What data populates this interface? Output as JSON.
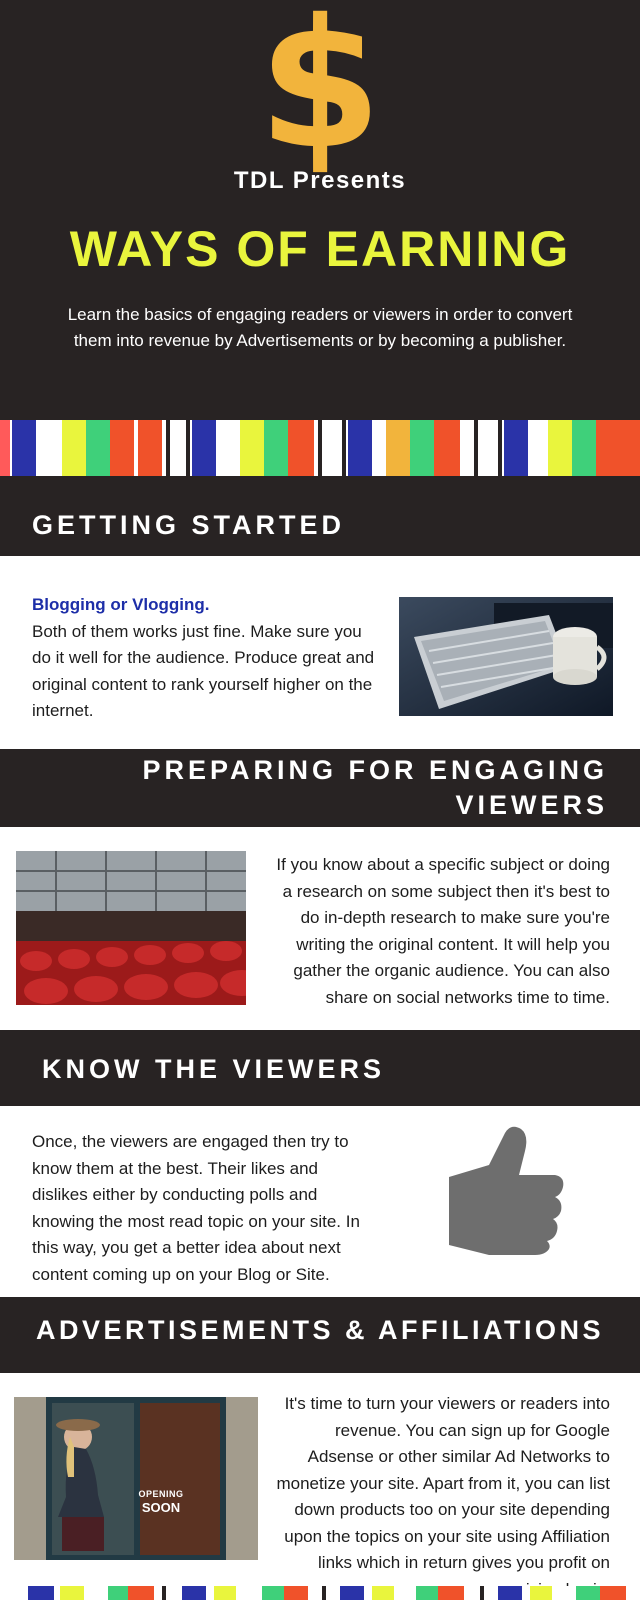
{
  "hero": {
    "icon": "dollar-icon",
    "icon_glyph": "$",
    "presents": "TDL Presents",
    "title": "WAYS OF EARNING",
    "subtitle": "Learn the basics of engaging readers or viewers in order to convert them into revenue by Advertisements or by becoming a publisher."
  },
  "colors": {
    "dark_band": "#282323",
    "dollar": "#f2b43c",
    "title": "#e9f53d",
    "kicker": "#1d2ea8",
    "strip_red": "#ff5a5a",
    "strip_blue": "#2a33a8",
    "strip_yellow": "#e9f53d",
    "strip_green": "#3fd07a",
    "strip_orange": "#f0522a",
    "strip_gold": "#f2b43c",
    "thumb": "#6e6e6e"
  },
  "sections": [
    {
      "heading": "GETTING STARTED",
      "kicker": "Blogging or Vlogging.",
      "text": "Both of them works just fine. Make sure you do it well for the audience. Produce great and original content to rank yourself higher on the internet.",
      "image": "keyboard-photo"
    },
    {
      "heading_line1": "PREPARING FOR ENGAGING",
      "heading_line2": "VIEWERS",
      "text": "If you know about a specific subject or doing a research on some subject then it's best to do in-depth research to make sure you're writing the original content. It will help you gather the organic audience. You can also share on social networks time to time.",
      "image": "auditorium-photo"
    },
    {
      "heading": "KNOW THE VIEWERS",
      "text": "Once, the viewers are engaged then try to know them at the best. Their likes and dislikes either by conducting polls and knowing the most read topic on your site. In this way, you get a better idea about next content coming up on your Blog or Site.",
      "image": "thumbs-up-icon"
    },
    {
      "heading": "ADVERTISEMENTS & AFFILIATIONS",
      "text": "It's time to turn your viewers or readers into revenue. You can sign up for Google Adsense or other similar Ad Networks to monetize your site. Apart from it, you can list down products too on your site depending upon the topics on your site using Affiliation links which in return gives you profit on commision basis.",
      "image": "storefront-photo",
      "sign_line1": "OPENING",
      "sign_line2": "SOON"
    }
  ]
}
